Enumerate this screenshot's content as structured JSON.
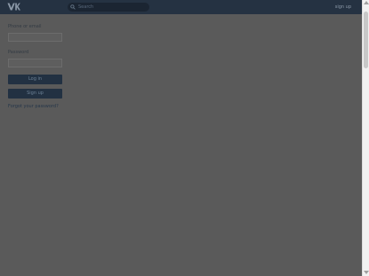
{
  "header": {
    "logo_text": "VK",
    "search_placeholder": "Search",
    "sign_up_link": "sign up"
  },
  "login": {
    "phone_label": "Phone or email",
    "phone_value": "",
    "password_label": "Password",
    "password_value": "",
    "login_button": "Log in",
    "signup_button": "Sign up",
    "forgot_link": "Forgot your password?"
  },
  "colors": {
    "topbar": "#253242",
    "background": "#5a5a5a",
    "button": "#223142"
  },
  "icons": [
    "vk-logo-icon",
    "search-icon",
    "scroll-up-icon",
    "scroll-down-icon"
  ]
}
